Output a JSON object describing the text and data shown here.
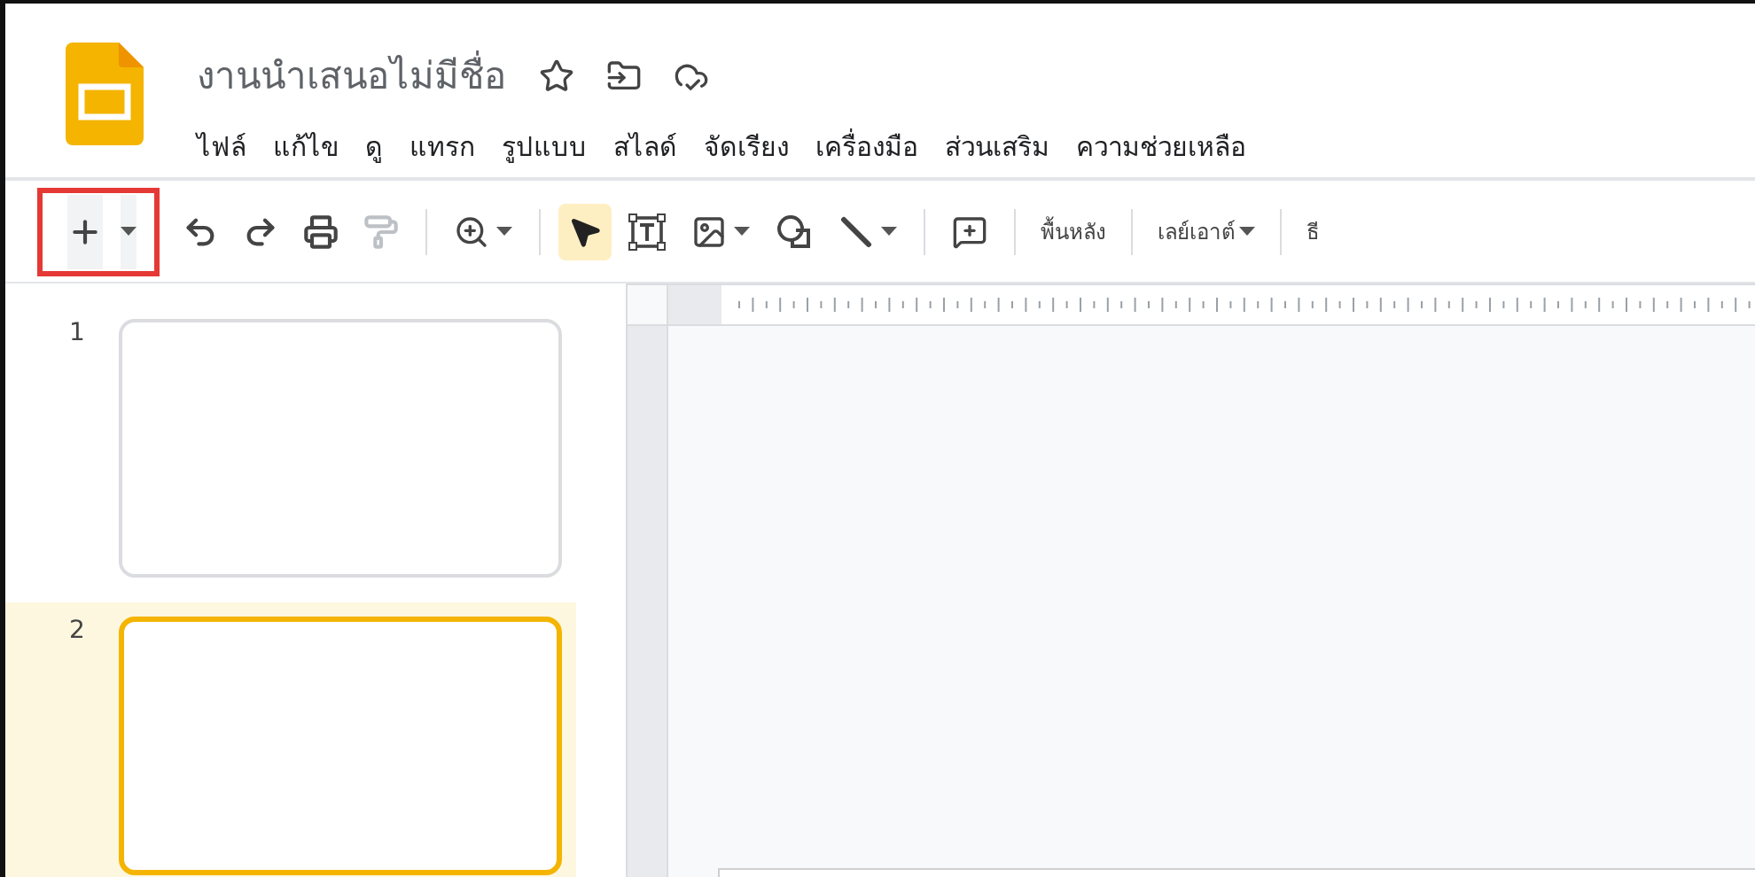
{
  "document": {
    "title": "งานนำเสนอไม่มีชื่อ"
  },
  "menu": [
    "ไฟล์",
    "แก้ไข",
    "ดู",
    "แทรก",
    "รูปแบบ",
    "สไลด์",
    "จัดเรียง",
    "เครื่องมือ",
    "ส่วนเสริม",
    "ความช่วยเหลือ"
  ],
  "toolbar": {
    "new_slide": {
      "highlighted": true
    },
    "paint_format": {
      "disabled": true
    },
    "select_tool": {
      "selected": true
    },
    "text_buttons": [
      {
        "label": "พื้นหลัง",
        "dropdown": false
      },
      {
        "label": "เลย์เอาต์",
        "dropdown": true
      },
      {
        "label": "ธี",
        "dropdown": false
      }
    ]
  },
  "slides": [
    {
      "number": "1",
      "selected": false
    },
    {
      "number": "2",
      "selected": true
    }
  ]
}
